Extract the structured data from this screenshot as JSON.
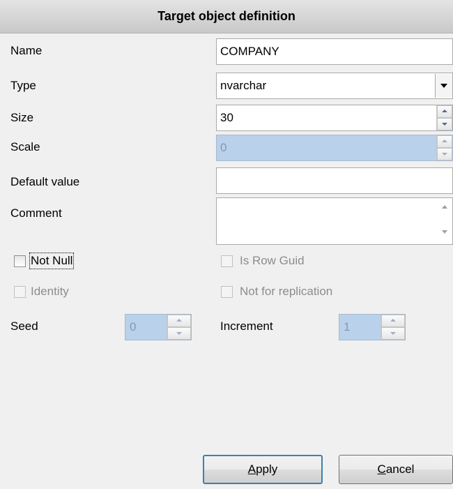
{
  "header": {
    "title": "Target object definition"
  },
  "fields": {
    "name": {
      "label": "Name",
      "value": "COMPANY"
    },
    "type": {
      "label": "Type",
      "value": "nvarchar"
    },
    "size": {
      "label": "Size",
      "value": "30"
    },
    "scale": {
      "label": "Scale",
      "value": "0"
    },
    "default_value": {
      "label": "Default value",
      "value": ""
    },
    "comment": {
      "label": "Comment",
      "value": ""
    }
  },
  "checkboxes": {
    "not_null": {
      "label": "Not Null",
      "checked": false
    },
    "is_row_guid": {
      "label": "Is Row Guid",
      "checked": false
    },
    "identity": {
      "label": "Identity",
      "checked": false
    },
    "not_for_replication": {
      "label": "Not for replication",
      "checked": false
    }
  },
  "seed": {
    "label": "Seed",
    "value": "0"
  },
  "increment": {
    "label": "Increment",
    "value": "1"
  },
  "buttons": {
    "apply": {
      "accel": "A",
      "rest": "pply"
    },
    "cancel": {
      "accel": "C",
      "rest": "ancel"
    }
  },
  "colors": {
    "disabled_fill": "#b9d1ea",
    "default_button_border": "#3c7fb1"
  }
}
